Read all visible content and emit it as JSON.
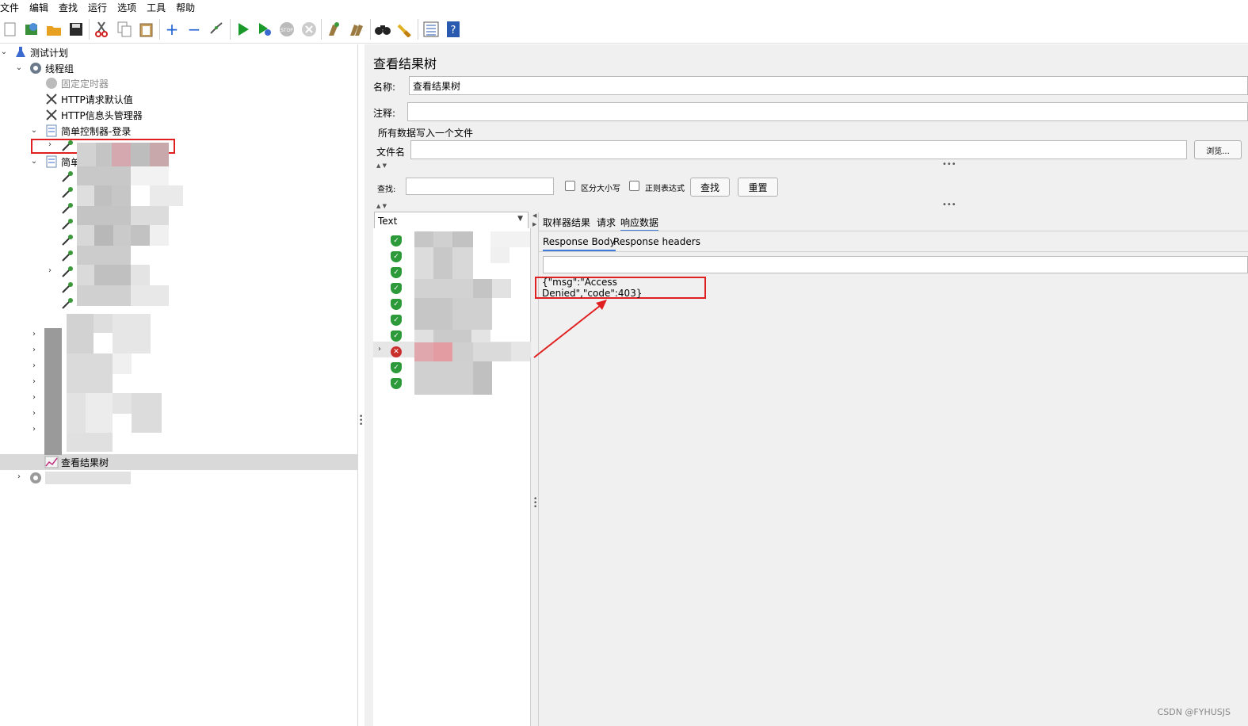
{
  "menu": [
    "文件",
    "编辑",
    "查找",
    "运行",
    "选项",
    "工具",
    "帮助"
  ],
  "toolbar_icons": [
    "new-icon",
    "templates-icon",
    "open-icon",
    "save-icon",
    "cut-icon",
    "copy-icon",
    "paste-icon",
    "expand-icon",
    "collapse-icon",
    "toggle-icon",
    "start-icon",
    "start-no-pause-icon",
    "stop-icon",
    "shutdown-icon",
    "clear-icon",
    "clear-all-icon",
    "search-icon",
    "reset-search-icon",
    "function-helper-icon",
    "help-icon"
  ],
  "tree": {
    "test_plan": "测试计划",
    "thread_group": "线程组",
    "timer": "固定定时器",
    "http_defaults": "HTTP请求默认值",
    "http_headers": "HTTP信息头管理器",
    "controller_login": "简单控制器-登录",
    "controller_2_prefix": "简单",
    "results_tree": "查看结果树"
  },
  "panel": {
    "title": "查看结果树",
    "name_label": "名称:",
    "name_value": "查看结果树",
    "comment_label": "注释:",
    "comment_value": "",
    "file_section": "所有数据写入一个文件",
    "filename_label": "文件名",
    "filename_value": "",
    "browse_button": "浏览...",
    "search_label": "查找:",
    "search_value": "",
    "case_sensitive": "区分大小写",
    "regex": "正则表达式",
    "find_button": "查找",
    "reset_button": "重置",
    "renderer": "Text",
    "result_tabs": [
      "取样器结果",
      "请求",
      "响应数据"
    ],
    "active_result_tab": "响应数据",
    "response_tabs": [
      "Response Body",
      "Response headers"
    ],
    "active_response_tab": "Response Body",
    "response_body": "{\"msg\":\"Access Denied\",\"code\":403}"
  },
  "colors": {
    "highlight_red": "#e02020",
    "ok_green": "#2d9a3a",
    "error_red": "#c9302c",
    "tab_accent": "#3d7bd9"
  },
  "watermark": "CSDN @FYHUSJS"
}
